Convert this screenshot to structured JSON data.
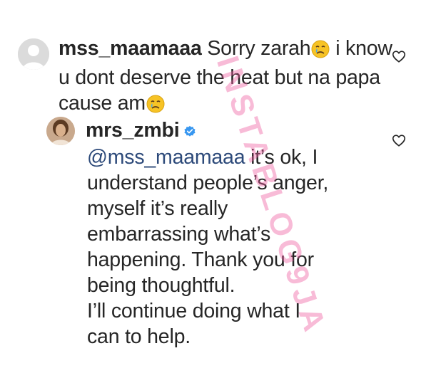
{
  "comments": [
    {
      "username": "mss_maamaaa",
      "text_part1": "Sorry zarah",
      "text_part2": "i know u dont deserve the heat but na papa cause am",
      "emoji": "crying-face"
    },
    {
      "username": "mrs_zmbi",
      "verified": true,
      "mention": "@mss_maamaaa",
      "line1_rest": "it’s ok, I",
      "line2": "understand people’s anger,",
      "line3": "myself it’s really",
      "line4": "embarrassing what’s",
      "line5": "happening. Thank you for",
      "line6": "being thoughtful.",
      "line7": "I’ll continue doing what I",
      "line8": "can to help."
    }
  ],
  "watermark": "INSTABLOG9JA",
  "colors": {
    "text": "#262626",
    "mention": "#2d4a7a",
    "verified": "#3897f0",
    "watermark": "#ee5ca0"
  }
}
